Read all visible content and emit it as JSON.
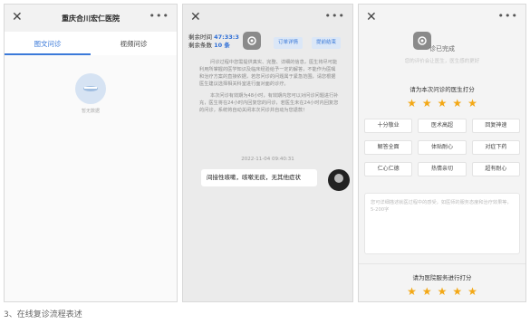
{
  "screen1": {
    "title": "重庆合川宏仁医院",
    "close": "✕",
    "more": "•••",
    "tabs": [
      "图文问诊",
      "视频问诊"
    ],
    "empty_text": "暂无数据"
  },
  "screen2": {
    "close": "✕",
    "more": "•••",
    "time_label": "剩余时间",
    "time_value": "47:33:3",
    "count_label": "剩余条数",
    "count_value": "10 条",
    "btn_order": "订单详情",
    "btn_end": "提前结束",
    "notice_p1": "问诊过程中您需提供真实、完整、详细的信息，医生将尽可能利用所掌握的医学知识及临床经验给予一定的解答，不能作为医嘱和治疗方案的直接依据，若您问诊的问题属于紧急范围，请您根据医生建议选择相关科室进行面对面的诊疗。",
    "notice_p2": "本次问诊有效期为48小时，有效期内您可以对问诊问题进行补充，医生将在24小时内回复您的问诊，若医生未在24小时内回复您的问诊，系统将自动关闭本次问诊并自动为您退款！",
    "timestamp": "2022-11-04 09:40:31",
    "message": "间接性咳嗽，咳嗽无痰，无其他症状"
  },
  "screen3": {
    "close": "✕",
    "more": "•••",
    "status": "诊已完成",
    "subtitle": "您的评价会让医生，医生感的更好",
    "doctor_rate_title": "请为本次问诊的医生打分",
    "doctor_stars": 5,
    "tags": [
      "十分敬业",
      "医术高超",
      "回复神速",
      "解答全面",
      "体贴耐心",
      "对症下药",
      "仁心仁德",
      "热情亲切",
      "超有耐心"
    ],
    "textarea_placeholder": "您可详细描述就医过程中的感受，如医师的服务态度和治疗效果等，5-200字",
    "hospital_rate_title": "请为医院服务进行打分",
    "hospital_stars": 5
  },
  "caption": "3、在线复诊流程表述",
  "colors": {
    "accent": "#3b7ad9",
    "star": "#f3a816"
  }
}
